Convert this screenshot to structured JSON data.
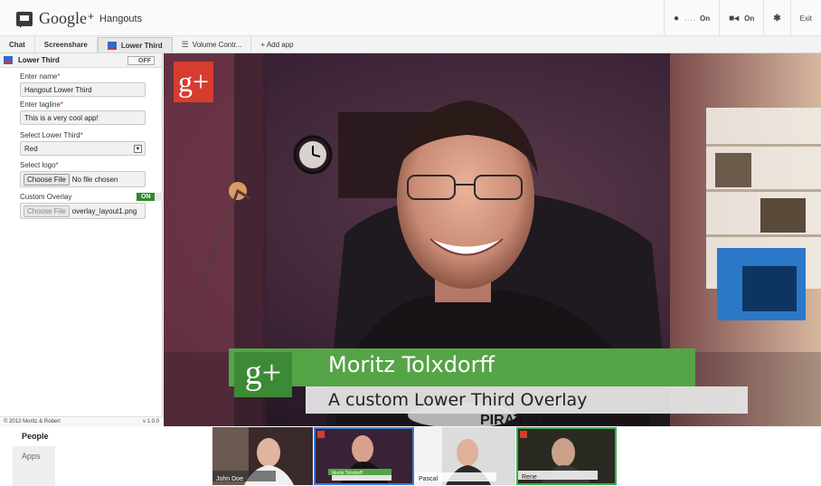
{
  "app": {
    "google": "Google",
    "plus": "+",
    "name": "Hangouts"
  },
  "controls": {
    "mic_state": "On",
    "cam_state": "On",
    "exit": "Exit"
  },
  "tabs": [
    {
      "label": "Chat"
    },
    {
      "label": "Screenshare"
    },
    {
      "label": "Lower Third"
    },
    {
      "label": "Volume Contr..."
    },
    {
      "label": "+ Add app"
    }
  ],
  "sidebar": {
    "title": "Lower Third",
    "toggle": "OFF",
    "name_label": "Enter name",
    "name_value": "Hangout Lower Third",
    "tagline_label": "Enter tagline",
    "tagline_value": "This is a very cool app!",
    "select_label": "Select Lower Third",
    "select_value": "Red",
    "logo_label": "Select logo",
    "logo_button": "Choose File",
    "logo_file": "No file chosen",
    "overlay_label": "Custom Overlay",
    "overlay_toggle": "ON",
    "overlay_button": "Choose File",
    "overlay_file": "overlay_layout1.png",
    "required_mark": "*",
    "copyright": "© 2012 Moritz & Robert",
    "version": "v 1.0.0"
  },
  "video": {
    "badge": "g+",
    "lower_third_name": "Moritz Tolxdorff",
    "lower_third_tagline": "A custom Lower Third Overlay"
  },
  "bottom_nav": {
    "people": "People",
    "apps": "Apps"
  },
  "participants": [
    {
      "name": "John Doe"
    },
    {
      "name": "Moritz Tolxdorff"
    },
    {
      "name": "Pascal"
    },
    {
      "name": "Rene"
    }
  ]
}
